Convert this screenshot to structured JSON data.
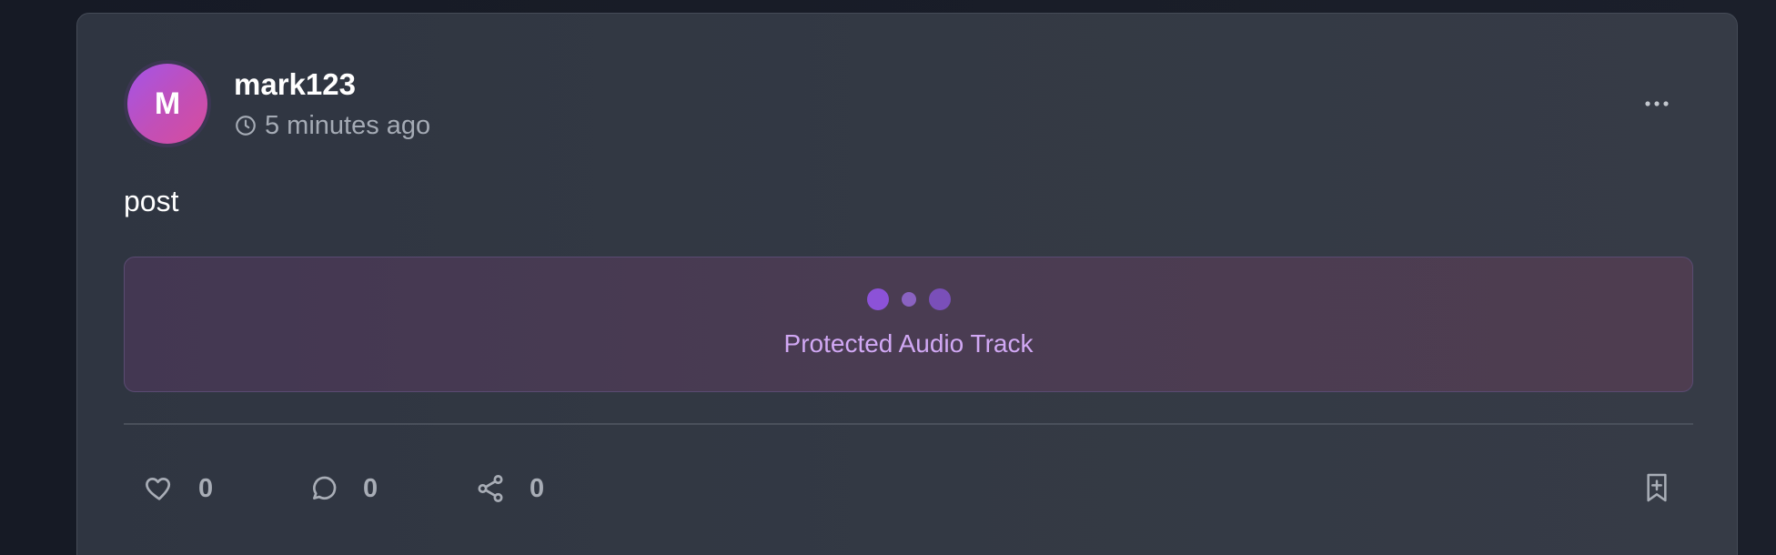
{
  "post": {
    "avatar_initial": "M",
    "username": "mark123",
    "timestamp": "5 minutes ago",
    "text": "post"
  },
  "audio": {
    "label": "Protected Audio Track",
    "colors": {
      "dot_primary": "#8c52d8",
      "dot_secondary": "#8a62c1",
      "dot_tertiary": "#7a4fb9",
      "label": "#d1a8f4"
    }
  },
  "actions": {
    "likes": {
      "icon": "heart-icon",
      "count": "0"
    },
    "comments": {
      "icon": "comment-icon",
      "count": "0"
    },
    "shares": {
      "icon": "share-icon",
      "count": "0"
    },
    "bookmark": {
      "icon": "bookmark-plus-icon"
    }
  },
  "menu": {
    "icon": "more-horizontal-icon"
  }
}
